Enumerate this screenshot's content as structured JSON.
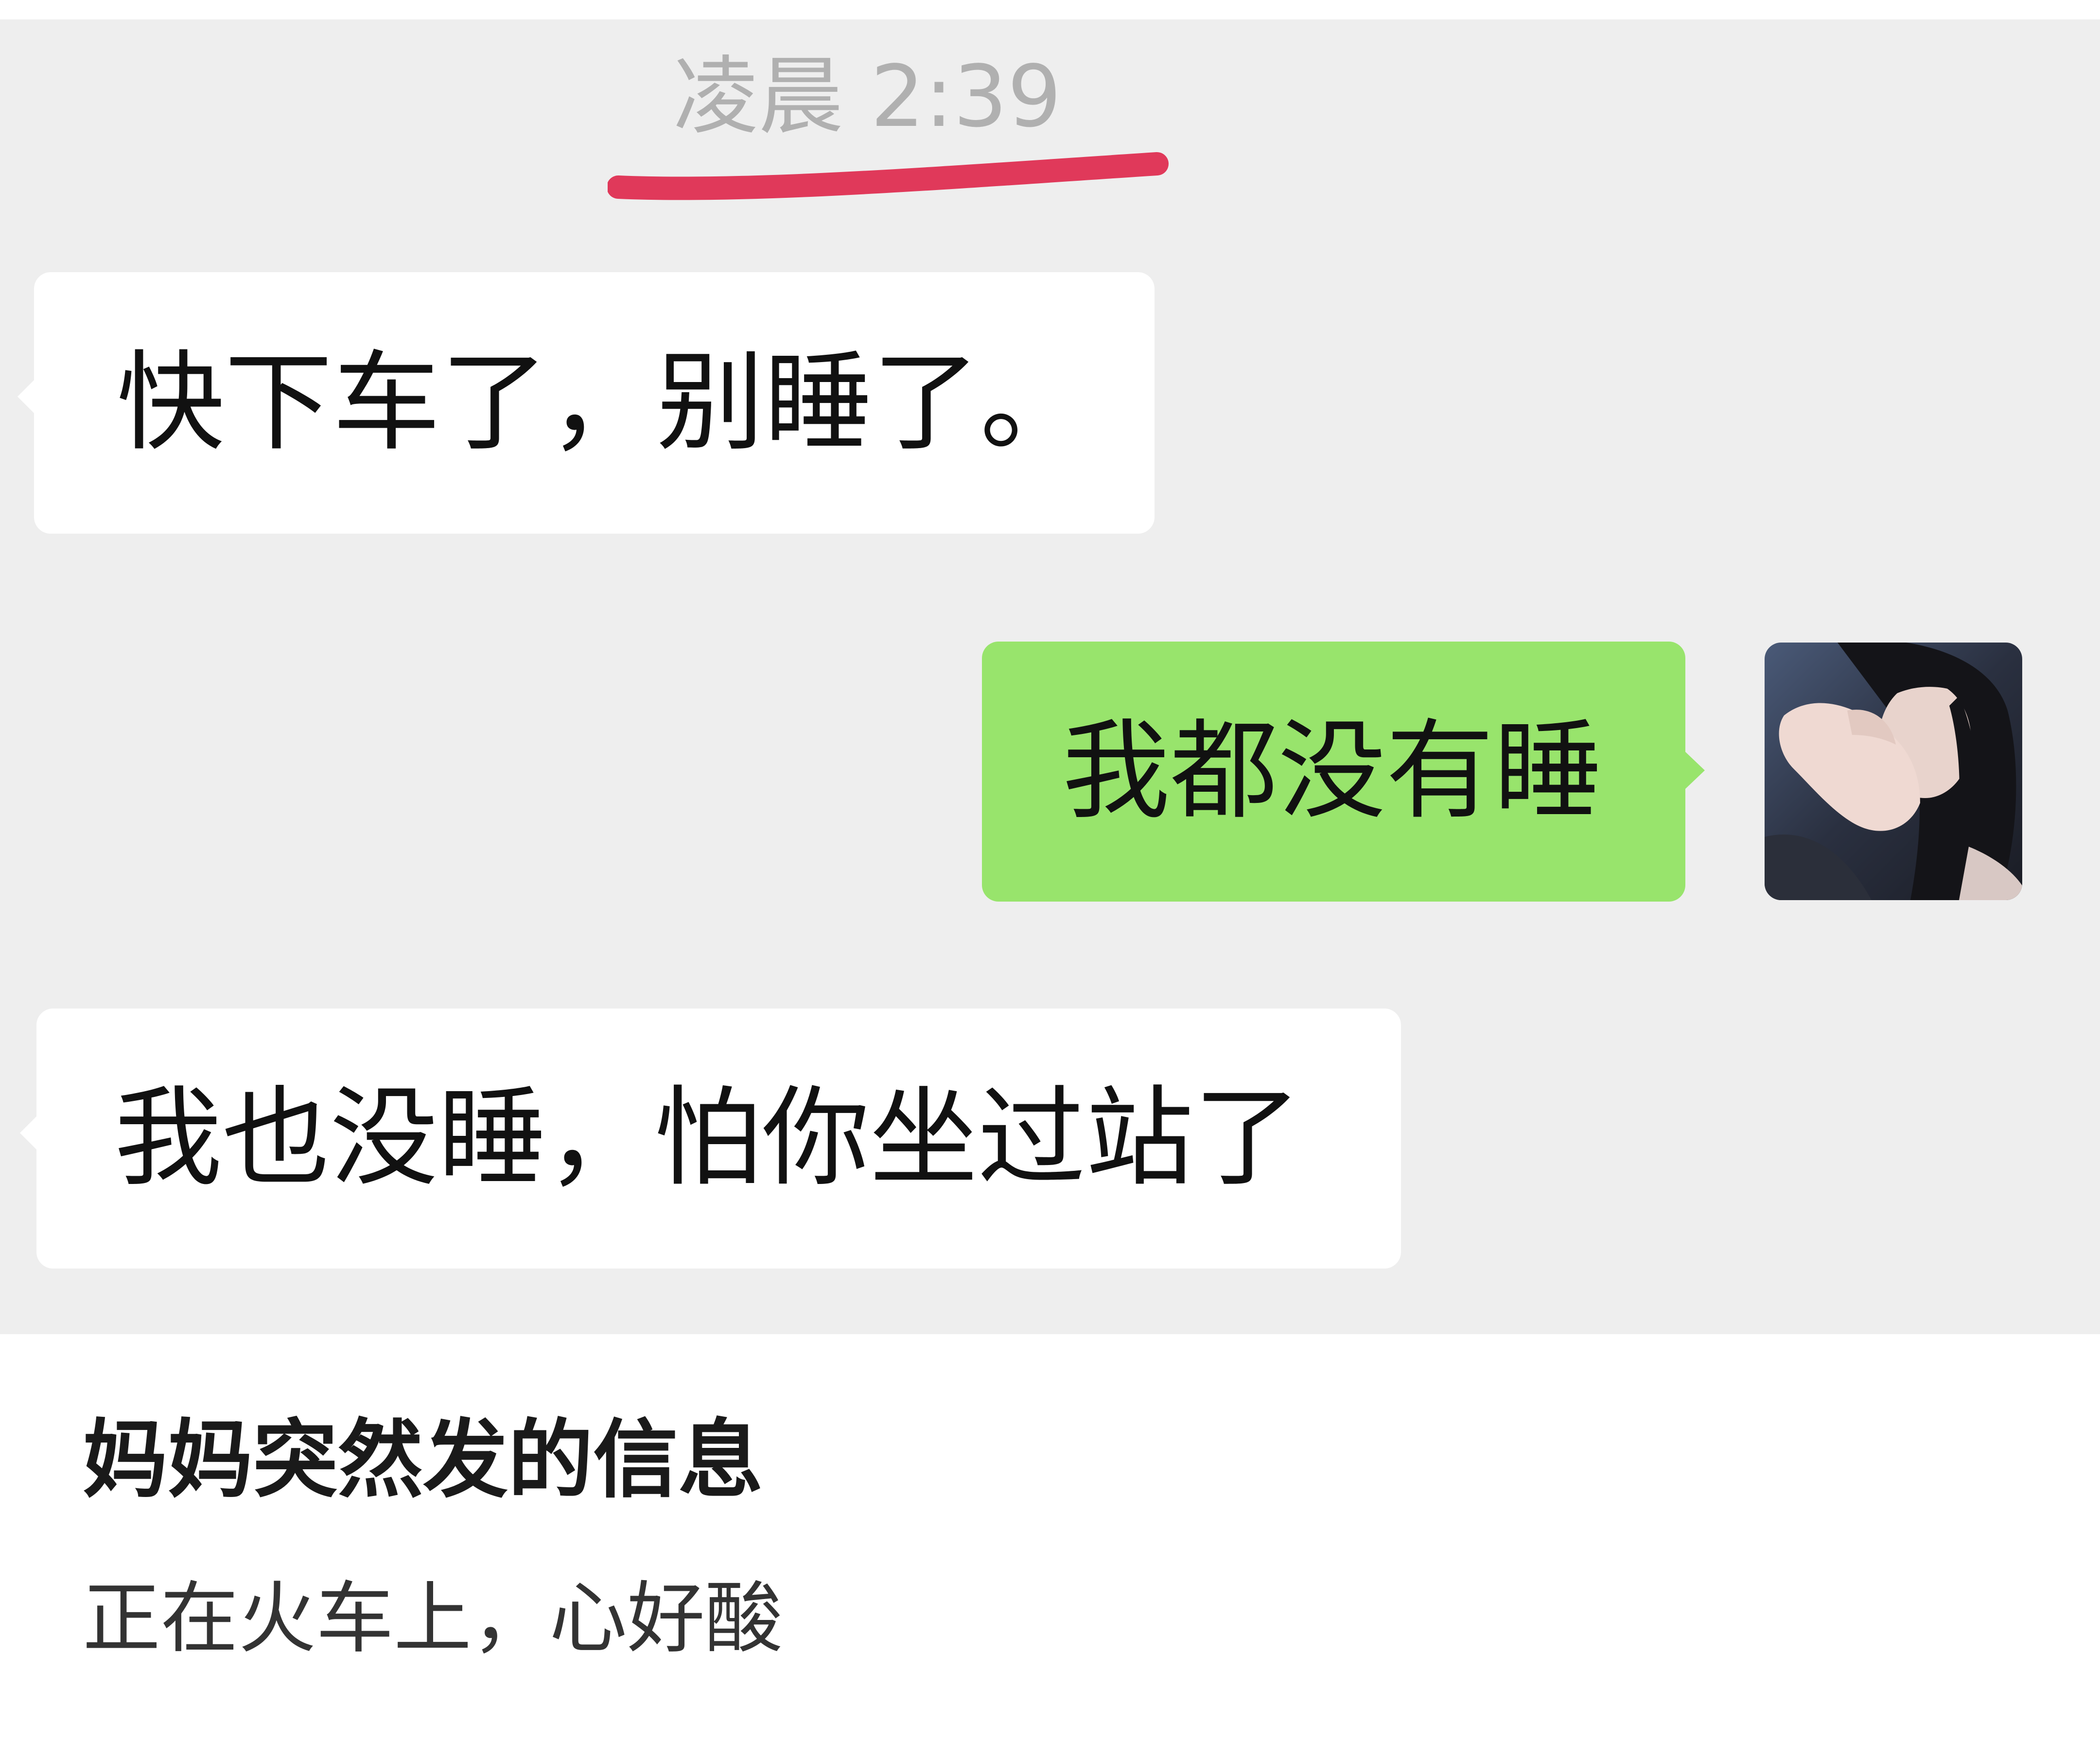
{
  "chat": {
    "timestamp": "凌晨 2:39",
    "annotation_color": "#e0395a",
    "messages": [
      {
        "side": "left",
        "text": "快下车了，别睡了。"
      },
      {
        "side": "right",
        "text": "我都没有睡",
        "bubble_color": "#98e46c"
      },
      {
        "side": "left",
        "text": "我也没睡，怕你坐过站了"
      }
    ]
  },
  "caption": {
    "title": "妈妈突然发的信息",
    "subtitle": "正在火车上，心好酸"
  }
}
